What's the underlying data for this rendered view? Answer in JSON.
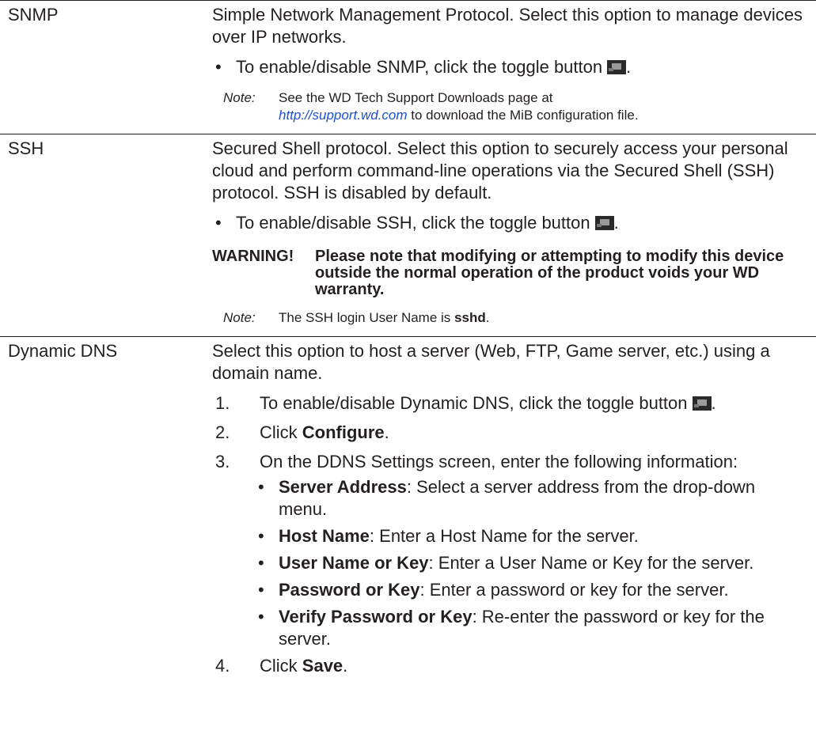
{
  "rows": {
    "snmp": {
      "label": "SNMP",
      "description": "Simple Network Management Protocol. Select this option to manage devices over IP networks.",
      "bullet": "To enable/disable SNMP, click the toggle button",
      "note_label": "Note:",
      "note_text_1": "See the WD Tech Support Downloads page at",
      "note_link": "http://support.wd.com",
      "note_text_2": " to download the MiB configuration file."
    },
    "ssh": {
      "label": "SSH",
      "description": "Secured Shell protocol. Select this option to securely access your personal cloud and perform command-line operations via the Secured Shell (SSH) protocol. SSH is disabled by default.",
      "bullet": "To enable/disable SSH, click the toggle button",
      "warning_label": "WARNING!",
      "warning_text": "Please note that modifying or attempting to modify this device outside the normal operation of the product voids your WD warranty.",
      "note_label": "Note:",
      "note_text": "The SSH login User Name is ",
      "note_bold": "sshd",
      "note_end": "."
    },
    "ddns": {
      "label": "Dynamic DNS",
      "description": "Select this option to host a server (Web, FTP, Game server, etc.) using a domain name.",
      "steps": {
        "s1_num": "1.",
        "s1_text": "To enable/disable Dynamic DNS, click the toggle button",
        "s2_num": "2.",
        "s2_pre": "Click ",
        "s2_bold": "Configure",
        "s2_post": ".",
        "s3_num": "3.",
        "s3_text": "On the DDNS Settings screen, enter the following information:",
        "s4_num": "4.",
        "s4_pre": "Click ",
        "s4_bold": "Save",
        "s4_post": "."
      },
      "fields": [
        {
          "name": "Server Address",
          "desc": ": Select a server address from the drop-down menu."
        },
        {
          "name": "Host Name",
          "desc": ": Enter a Host Name for the server."
        },
        {
          "name": "User Name or Key",
          "desc": ": Enter a User Name or Key for the server."
        },
        {
          "name": "Password or Key",
          "desc": ": Enter a password or key for the server."
        },
        {
          "name": "Verify Password or Key",
          "desc": ": Re-enter the password or key for the server."
        }
      ]
    }
  },
  "bullet_char": "•",
  "toggle_icon": "toggle-button-icon"
}
